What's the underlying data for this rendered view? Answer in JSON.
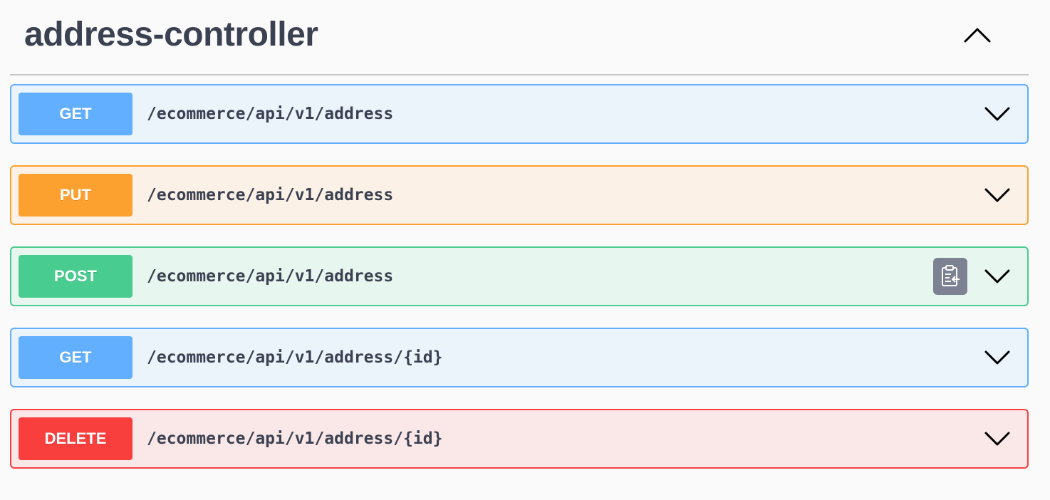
{
  "section": {
    "title": "address-controller",
    "collapse_icon": "chevron-up-icon"
  },
  "operations": [
    {
      "method": "GET",
      "path": "/ecommerce/api/v1/address"
    },
    {
      "method": "PUT",
      "path": "/ecommerce/api/v1/address"
    },
    {
      "method": "POST",
      "path": "/ecommerce/api/v1/address",
      "copy_icon": "clipboard-copy-icon"
    },
    {
      "method": "GET",
      "path": "/ecommerce/api/v1/address/{id}"
    },
    {
      "method": "DELETE",
      "path": "/ecommerce/api/v1/address/{id}"
    }
  ],
  "colors": {
    "GET": "#61affe",
    "PUT": "#fca130",
    "POST": "#49cc90",
    "DELETE": "#f93e3e",
    "title_text": "#3b4151"
  }
}
